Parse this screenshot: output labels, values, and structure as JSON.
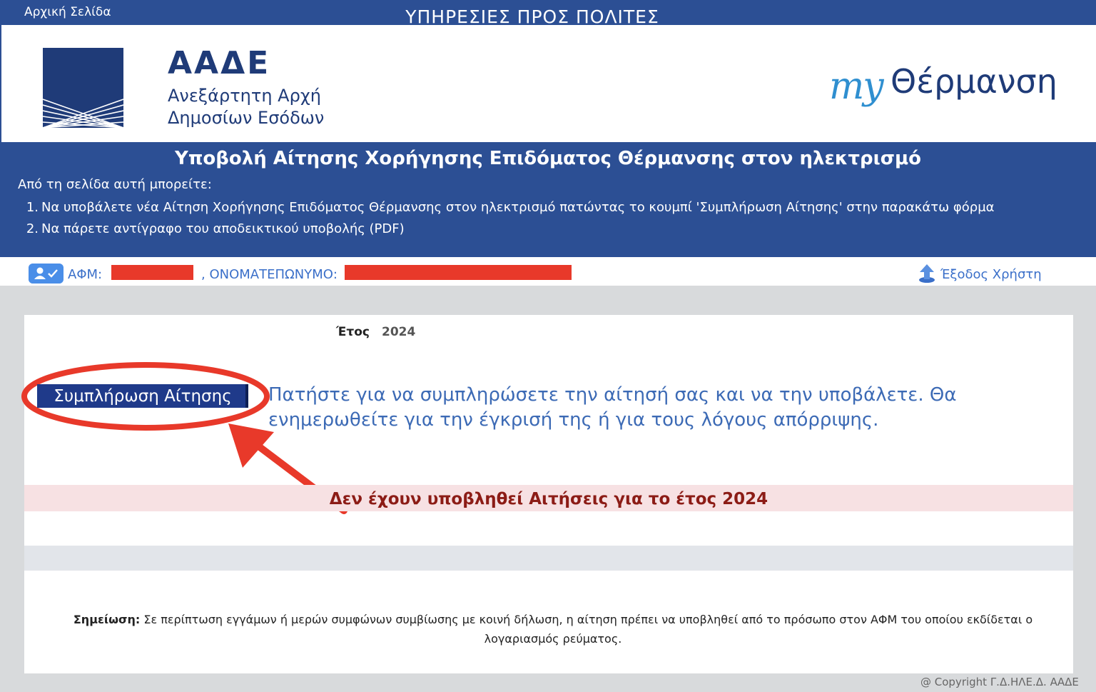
{
  "topbar": {
    "home_link": "Αρχική Σελίδα",
    "services_title": "ΥΠΗΡΕΣΙΕΣ ΠΡΟΣ ΠΟΛΙΤΕΣ"
  },
  "header": {
    "org_short": "ΑΑΔΕ",
    "org_full_line1": "Ανεξάρτητη Αρχή",
    "org_full_line2": "Δημοσίων Εσόδων",
    "brand_my": "my",
    "brand_name": "Θέρμανση"
  },
  "panel": {
    "title": "Υποβολή Αίτησης Χορήγησης Επιδόματος Θέρμανσης στον ηλεκτρισμό",
    "intro": "Από τη σελίδα αυτή μπορείτε:",
    "items": [
      {
        "num": "1.",
        "text": "Να υποβάλετε νέα Αίτηση Χορήγησης Επιδόματος Θέρμανσης στον ηλεκτρισμό πατώντας το κουμπί 'Συμπλήρωση Αίτησης' στην παρακάτω φόρμα"
      },
      {
        "num": "2.",
        "text": "Να πάρετε αντίγραφο του αποδεικτικού υποβολής (PDF)"
      }
    ]
  },
  "user": {
    "afm_label": "ΑΦΜ:",
    "name_label": ", ΟΝΟΜΑΤΕΠΩΝΥΜΟ:",
    "logout_label": "Έξοδος Χρήστη"
  },
  "form": {
    "year_label": "Έτος",
    "year_value": "2024",
    "fill_button": "Συμπλήρωση Αίτησης",
    "fill_help": "Πατήστε για να συμπληρώσετε την αίτησή σας και να την υποβάλετε. Θα ενημερωθείτε για την έγκρισή της ή για τους λόγους απόρριψης.",
    "no_applications": "Δεν έχουν υποβληθεί Αιτήσεις για το έτος 2024",
    "note_label": "Σημείωση:",
    "note_text": " Σε περίπτωση εγγάμων ή μερών συμφώνων συμβίωσης με κοινή δήλωση, η αίτηση πρέπει να υποβληθεί από το πρόσωπο στον ΑΦΜ του οποίου εκδίδεται ο λογαριασμός ρεύματος."
  },
  "footer": {
    "copyright": "@ Copyright Γ.Δ.ΗΛΕ.Δ. ΑΑΔΕ"
  },
  "colors": {
    "primary_blue": "#2c4f94",
    "annotation_red": "#e8392a",
    "error_text": "#8c1c16"
  }
}
